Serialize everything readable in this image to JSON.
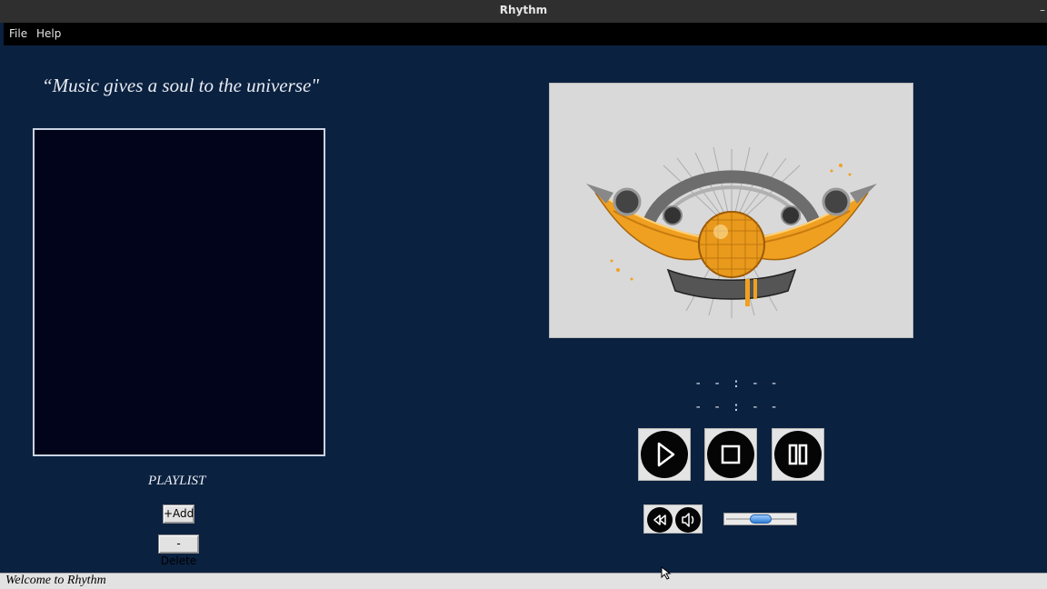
{
  "window": {
    "title": "Rhythm",
    "close_glyph": "–"
  },
  "menu": {
    "items": [
      {
        "label": "File"
      },
      {
        "label": "Help"
      }
    ]
  },
  "quote": "“Music gives a soul to the universe\"",
  "playlist": {
    "label": "PLAYLIST",
    "items": [],
    "add_label": "+Add",
    "delete_label": "-Delete"
  },
  "album_art": {
    "description_icon": "disco-ball-winged-emblem-icon"
  },
  "time": {
    "current": "- - : - -",
    "total": "- - : - -"
  },
  "controls": {
    "play_icon": "play-icon",
    "stop_icon": "stop-icon",
    "pause_icon": "pause-icon",
    "rewind_icon": "rewind-icon",
    "mute_icon": "speaker-mute-icon"
  },
  "volume": {
    "value_fraction": 0.5
  },
  "status": {
    "text": "Welcome to Rhythm"
  },
  "colors": {
    "background": "#0b2140",
    "playlist_bg": "#01041a",
    "accent_orange": "#f0a020"
  }
}
